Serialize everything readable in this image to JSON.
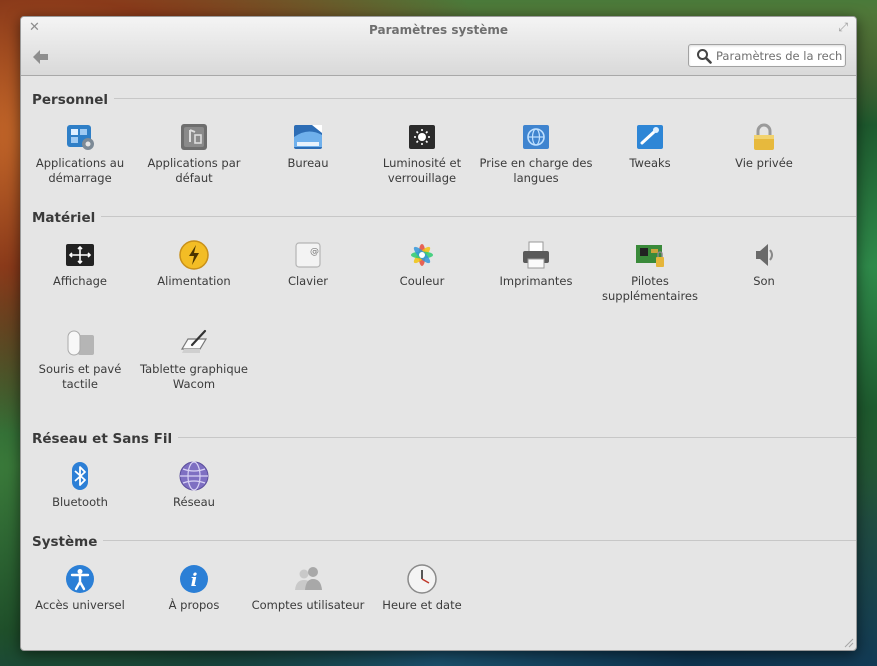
{
  "window": {
    "title": "Paramètres système",
    "close_icon": "close-icon",
    "maximize_icon": "maximize-icon"
  },
  "toolbar": {
    "back_icon": "back-arrow-icon",
    "search_placeholder": "Paramètres de la recherche"
  },
  "sections": {
    "personal": {
      "title": "Personnel",
      "items": [
        {
          "label": "Applications au démarrage",
          "icon": "startup-apps-icon"
        },
        {
          "label": "Applications par défaut",
          "icon": "default-apps-icon"
        },
        {
          "label": "Bureau",
          "icon": "desktop-icon"
        },
        {
          "label": "Luminosité et verrouillage",
          "icon": "brightness-lock-icon"
        },
        {
          "label": "Prise en charge des langues",
          "icon": "language-support-icon"
        },
        {
          "label": "Tweaks",
          "icon": "tweaks-icon"
        },
        {
          "label": "Vie privée",
          "icon": "privacy-lock-icon"
        }
      ]
    },
    "hardware": {
      "title": "Matériel",
      "items": [
        {
          "label": "Affichage",
          "icon": "display-icon"
        },
        {
          "label": "Alimentation",
          "icon": "power-icon"
        },
        {
          "label": "Clavier",
          "icon": "keyboard-icon"
        },
        {
          "label": "Couleur",
          "icon": "color-icon"
        },
        {
          "label": "Imprimantes",
          "icon": "printer-icon"
        },
        {
          "label": "Pilotes supplémentaires",
          "icon": "drivers-icon"
        },
        {
          "label": "Son",
          "icon": "sound-icon"
        },
        {
          "label": "Souris et pavé tactile",
          "icon": "mouse-icon"
        },
        {
          "label": "Tablette graphique Wacom",
          "icon": "wacom-tablet-icon"
        }
      ]
    },
    "network": {
      "title": "Réseau et Sans Fil",
      "items": [
        {
          "label": "Bluetooth",
          "icon": "bluetooth-icon"
        },
        {
          "label": "Réseau",
          "icon": "network-icon"
        }
      ]
    },
    "system": {
      "title": "Système",
      "items": [
        {
          "label": "Accès universel",
          "icon": "accessibility-icon"
        },
        {
          "label": "À propos",
          "icon": "about-info-icon"
        },
        {
          "label": "Comptes utilisateur",
          "icon": "user-accounts-icon"
        },
        {
          "label": "Heure et date",
          "icon": "clock-icon"
        }
      ]
    }
  }
}
